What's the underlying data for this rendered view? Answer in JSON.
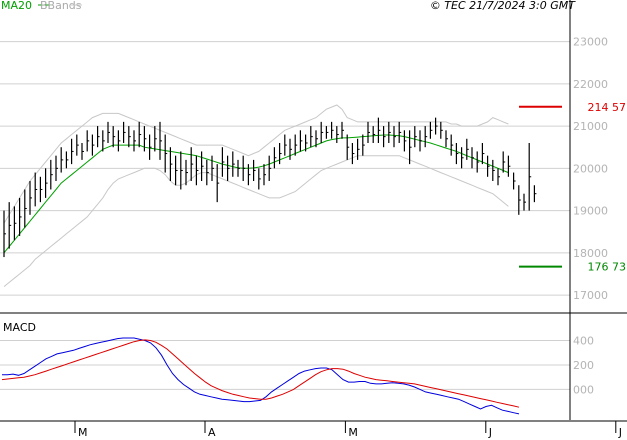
{
  "header": {
    "legend_ma": "MA20",
    "legend_bb": "BBands",
    "copyright": "© TEC 21/7/2024 3:0 GMT"
  },
  "colors": {
    "ma": "#00a000",
    "bands": "#c8c8c8",
    "price": "#000000",
    "macd": "#0000dd",
    "signal": "#dd0000",
    "resistance": "#dd0000",
    "support": "#008800",
    "grid": "#d0d0d0"
  },
  "chart_data": [
    {
      "type": "ohlc-bar",
      "yaxis": {
        "ylim": [
          16600,
          23700
        ],
        "ticks": [
          17000,
          18000,
          19000,
          20000,
          21000,
          22000,
          23000
        ],
        "tick_labels": [
          "17000",
          "18000",
          "19000",
          "20000",
          "21000",
          "22000",
          "23000"
        ]
      },
      "xaxis": {
        "tick_labels": [
          "M",
          "A",
          "M",
          "J",
          "J"
        ],
        "tick_index": [
          15,
          40,
          67,
          94,
          119
        ]
      },
      "levels": [
        {
          "label": "214 57",
          "value": 21457,
          "color": "resistance"
        },
        {
          "label": "176 73",
          "value": 17673,
          "color": "support"
        }
      ],
      "series": {
        "bars": [
          {
            "h": 19000,
            "l": 17900
          },
          {
            "h": 19200,
            "l": 18100
          },
          {
            "h": 19100,
            "l": 18300
          },
          {
            "h": 19300,
            "l": 18400
          },
          {
            "h": 19500,
            "l": 18600
          },
          {
            "h": 19700,
            "l": 18900
          },
          {
            "h": 19900,
            "l": 19100
          },
          {
            "h": 19800,
            "l": 19200
          },
          {
            "h": 20000,
            "l": 19300
          },
          {
            "h": 20200,
            "l": 19500
          },
          {
            "h": 20300,
            "l": 19700
          },
          {
            "h": 20500,
            "l": 19900
          },
          {
            "h": 20400,
            "l": 20000
          },
          {
            "h": 20700,
            "l": 20100
          },
          {
            "h": 20800,
            "l": 20300
          },
          {
            "h": 20600,
            "l": 20200
          },
          {
            "h": 20900,
            "l": 20400
          },
          {
            "h": 20800,
            "l": 20300
          },
          {
            "h": 21000,
            "l": 20500
          },
          {
            "h": 20900,
            "l": 20400
          },
          {
            "h": 21100,
            "l": 20600
          },
          {
            "h": 21000,
            "l": 20500
          },
          {
            "h": 20900,
            "l": 20400
          },
          {
            "h": 21100,
            "l": 20600
          },
          {
            "h": 21000,
            "l": 20500
          },
          {
            "h": 20900,
            "l": 20400
          },
          {
            "h": 21100,
            "l": 20500
          },
          {
            "h": 21000,
            "l": 20400
          },
          {
            "h": 20800,
            "l": 20200
          },
          {
            "h": 21000,
            "l": 20400
          },
          {
            "h": 21100,
            "l": 20200
          },
          {
            "h": 20800,
            "l": 19900
          },
          {
            "h": 20500,
            "l": 19700
          },
          {
            "h": 20300,
            "l": 19600
          },
          {
            "h": 20400,
            "l": 19500
          },
          {
            "h": 20200,
            "l": 19600
          },
          {
            "h": 20500,
            "l": 19700
          },
          {
            "h": 20300,
            "l": 19600
          },
          {
            "h": 20400,
            "l": 19700
          },
          {
            "h": 20200,
            "l": 19600
          },
          {
            "h": 20300,
            "l": 19700
          },
          {
            "h": 20100,
            "l": 19200
          },
          {
            "h": 20500,
            "l": 19800
          },
          {
            "h": 20300,
            "l": 19700
          },
          {
            "h": 20400,
            "l": 19800
          },
          {
            "h": 20200,
            "l": 19800
          },
          {
            "h": 20300,
            "l": 19700
          },
          {
            "h": 20100,
            "l": 19600
          },
          {
            "h": 20200,
            "l": 19700
          },
          {
            "h": 20000,
            "l": 19500
          },
          {
            "h": 20100,
            "l": 19600
          },
          {
            "h": 20300,
            "l": 19700
          },
          {
            "h": 20500,
            "l": 20000
          },
          {
            "h": 20600,
            "l": 20100
          },
          {
            "h": 20800,
            "l": 20300
          },
          {
            "h": 20700,
            "l": 20200
          },
          {
            "h": 20800,
            "l": 20300
          },
          {
            "h": 20900,
            "l": 20400
          },
          {
            "h": 20800,
            "l": 20400
          },
          {
            "h": 21000,
            "l": 20500
          },
          {
            "h": 20900,
            "l": 20500
          },
          {
            "h": 21100,
            "l": 20600
          },
          {
            "h": 21000,
            "l": 20700
          },
          {
            "h": 21100,
            "l": 20700
          },
          {
            "h": 21000,
            "l": 20600
          },
          {
            "h": 21100,
            "l": 20700
          },
          {
            "h": 20800,
            "l": 20200
          },
          {
            "h": 20600,
            "l": 20100
          },
          {
            "h": 20700,
            "l": 20200
          },
          {
            "h": 20800,
            "l": 20300
          },
          {
            "h": 21100,
            "l": 20600
          },
          {
            "h": 21000,
            "l": 20600
          },
          {
            "h": 21200,
            "l": 20600
          },
          {
            "h": 21000,
            "l": 20500
          },
          {
            "h": 21100,
            "l": 20600
          },
          {
            "h": 21000,
            "l": 20500
          },
          {
            "h": 21100,
            "l": 20600
          },
          {
            "h": 20900,
            "l": 20400
          },
          {
            "h": 20900,
            "l": 20100
          },
          {
            "h": 21000,
            "l": 20500
          },
          {
            "h": 20900,
            "l": 20400
          },
          {
            "h": 21000,
            "l": 20500
          },
          {
            "h": 21100,
            "l": 20700
          },
          {
            "h": 21200,
            "l": 20800
          },
          {
            "h": 21100,
            "l": 20700
          },
          {
            "h": 20900,
            "l": 20500
          },
          {
            "h": 20800,
            "l": 20300
          },
          {
            "h": 20600,
            "l": 20100
          },
          {
            "h": 20500,
            "l": 20000
          },
          {
            "h": 20700,
            "l": 20200
          },
          {
            "h": 20500,
            "l": 20000
          },
          {
            "h": 20400,
            "l": 19900
          },
          {
            "h": 20600,
            "l": 20100
          },
          {
            "h": 20300,
            "l": 19800
          },
          {
            "h": 20200,
            "l": 19700
          },
          {
            "h": 20000,
            "l": 19600
          },
          {
            "h": 20400,
            "l": 19900
          },
          {
            "h": 20300,
            "l": 19800
          },
          {
            "h": 19900,
            "l": 19500
          },
          {
            "h": 19600,
            "l": 18900
          },
          {
            "h": 19400,
            "l": 19000
          },
          {
            "h": 20600,
            "l": 19000
          },
          {
            "h": 19600,
            "l": 19200
          }
        ],
        "ma20": [
          18000,
          18150,
          18300,
          18450,
          18600,
          18750,
          18900,
          19050,
          19200,
          19350,
          19500,
          19650,
          19750,
          19850,
          19950,
          20050,
          20150,
          20250,
          20350,
          20450,
          20500,
          20550,
          20550,
          20550,
          20550,
          20550,
          20550,
          20500,
          20480,
          20460,
          20440,
          20420,
          20400,
          20380,
          20360,
          20340,
          20320,
          20300,
          20260,
          20220,
          20180,
          20140,
          20100,
          20070,
          20040,
          20010,
          20000,
          20000,
          20010,
          20030,
          20060,
          20100,
          20150,
          20200,
          20250,
          20300,
          20350,
          20400,
          20450,
          20500,
          20550,
          20600,
          20650,
          20680,
          20700,
          20720,
          20720,
          20730,
          20740,
          20750,
          20760,
          20770,
          20780,
          20790,
          20790,
          20780,
          20770,
          20750,
          20720,
          20690,
          20660,
          20630,
          20600,
          20560,
          20520,
          20480,
          20440,
          20400,
          20350,
          20300,
          20250,
          20200,
          20150,
          20100,
          20050,
          20000,
          19950,
          19900
        ],
        "upper": [
          18700,
          18900,
          19100,
          19300,
          19500,
          19700,
          19850,
          20000,
          20150,
          20300,
          20450,
          20600,
          20700,
          20800,
          20900,
          21000,
          21100,
          21200,
          21250,
          21300,
          21300,
          21300,
          21300,
          21250,
          21200,
          21150,
          21100,
          21050,
          21000,
          20950,
          20900,
          20850,
          20800,
          20750,
          20700,
          20650,
          20600,
          20550,
          20550,
          20550,
          20550,
          20550,
          20550,
          20500,
          20450,
          20400,
          20350,
          20300,
          20350,
          20400,
          20500,
          20600,
          20700,
          20800,
          20900,
          20950,
          21000,
          21050,
          21100,
          21150,
          21200,
          21300,
          21400,
          21450,
          21500,
          21400,
          21200,
          21150,
          21100,
          21100,
          21100,
          21100,
          21100,
          21100,
          21100,
          21100,
          21100,
          21100,
          21100,
          21100,
          21100,
          21100,
          21100,
          21100,
          21100,
          21100,
          21050,
          21050,
          21000,
          21000,
          21000,
          21000,
          21050,
          21100,
          21200,
          21150,
          21100,
          21050
        ],
        "lower": [
          17200,
          17300,
          17400,
          17500,
          17600,
          17700,
          17850,
          17950,
          18050,
          18150,
          18250,
          18350,
          18450,
          18550,
          18650,
          18750,
          18850,
          19000,
          19150,
          19300,
          19500,
          19650,
          19750,
          19800,
          19850,
          19900,
          19950,
          20000,
          20000,
          20000,
          19950,
          19850,
          19700,
          19600,
          19600,
          19650,
          19750,
          19850,
          19900,
          19900,
          19850,
          19800,
          19750,
          19700,
          19650,
          19600,
          19550,
          19500,
          19450,
          19400,
          19350,
          19300,
          19300,
          19300,
          19350,
          19400,
          19450,
          19550,
          19650,
          19750,
          19850,
          19950,
          20000,
          20050,
          20100,
          20150,
          20200,
          20250,
          20300,
          20300,
          20300,
          20300,
          20300,
          20300,
          20300,
          20300,
          20300,
          20250,
          20200,
          20150,
          20100,
          20050,
          20000,
          19950,
          19900,
          19850,
          19800,
          19750,
          19700,
          19650,
          19600,
          19550,
          19500,
          19450,
          19400,
          19300,
          19200,
          19100
        ]
      }
    },
    {
      "type": "line",
      "title": "MACD",
      "yaxis": {
        "ylim": [
          -250,
          600
        ],
        "ticks": [
          0,
          200,
          400
        ],
        "tick_labels": [
          "000",
          "200",
          "400"
        ]
      },
      "series": [
        {
          "name": "macd",
          "values": [
            120,
            120,
            125,
            115,
            130,
            160,
            190,
            220,
            250,
            270,
            290,
            300,
            310,
            320,
            335,
            350,
            365,
            375,
            385,
            395,
            405,
            415,
            420,
            420,
            420,
            410,
            400,
            380,
            340,
            280,
            200,
            130,
            80,
            40,
            10,
            -20,
            -40,
            -50,
            -60,
            -70,
            -80,
            -85,
            -90,
            -95,
            -100,
            -100,
            -95,
            -90,
            -60,
            -20,
            10,
            40,
            70,
            100,
            130,
            150,
            160,
            170,
            175,
            175,
            160,
            120,
            80,
            60,
            60,
            65,
            65,
            50,
            45,
            45,
            50,
            55,
            50,
            45,
            35,
            20,
            0,
            -20,
            -30,
            -40,
            -50,
            -60,
            -70,
            -80,
            -100,
            -120,
            -140,
            -160,
            -140,
            -130,
            -150,
            -170,
            -180,
            -190,
            -200
          ]
        },
        {
          "name": "signal",
          "values": [
            80,
            85,
            90,
            95,
            100,
            110,
            120,
            135,
            150,
            165,
            180,
            195,
            210,
            225,
            240,
            255,
            270,
            285,
            300,
            315,
            330,
            345,
            360,
            375,
            390,
            400,
            405,
            400,
            385,
            360,
            330,
            290,
            250,
            210,
            170,
            130,
            95,
            60,
            30,
            10,
            -10,
            -25,
            -40,
            -50,
            -60,
            -70,
            -75,
            -80,
            -80,
            -70,
            -55,
            -40,
            -20,
            0,
            30,
            60,
            90,
            120,
            145,
            160,
            170,
            170,
            165,
            150,
            130,
            115,
            100,
            90,
            80,
            75,
            70,
            65,
            60,
            55,
            50,
            45,
            35,
            25,
            15,
            5,
            -5,
            -15,
            -25,
            -35,
            -45,
            -55,
            -65,
            -75,
            -85,
            -95,
            -105,
            -115,
            -125,
            -135,
            -145
          ]
        }
      ]
    }
  ]
}
